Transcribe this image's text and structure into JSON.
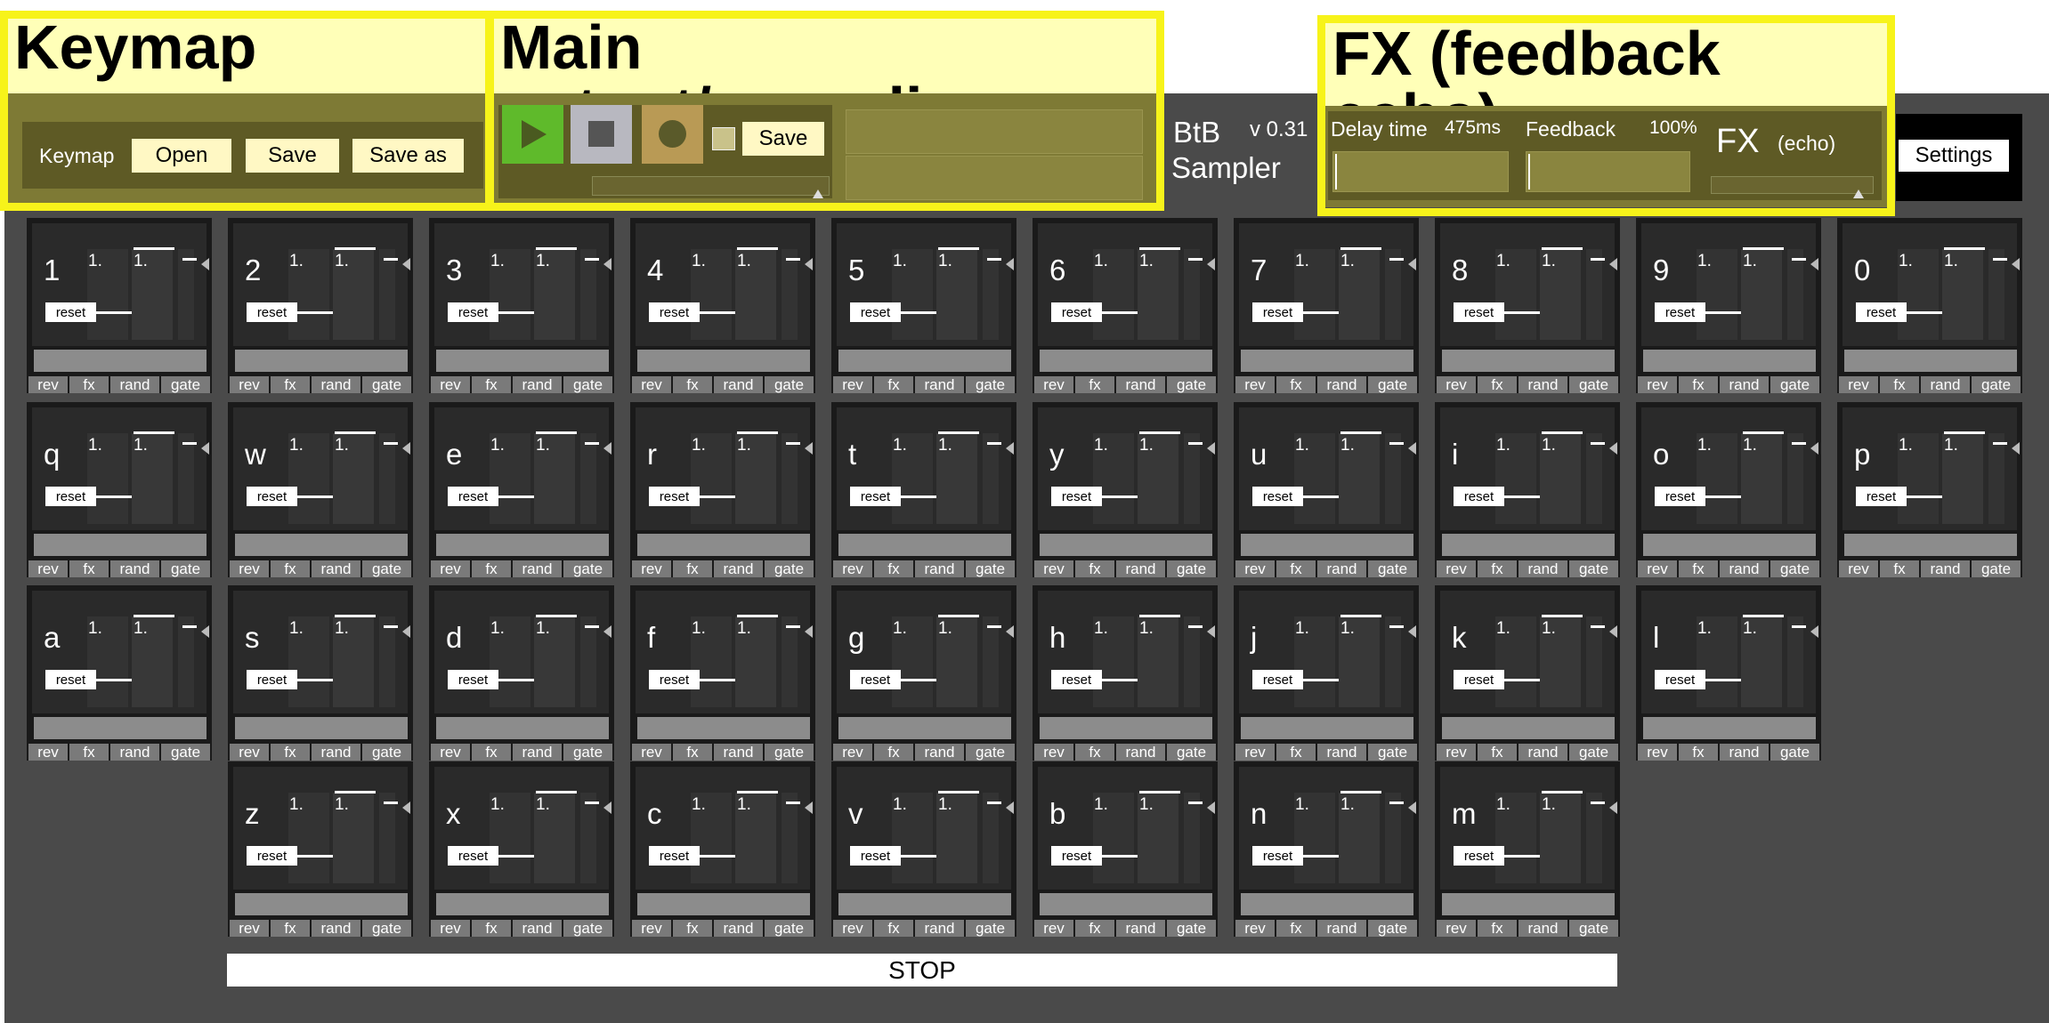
{
  "app": {
    "name_line1": "BtB",
    "name_line2": "Sampler",
    "version": "v 0.31"
  },
  "settings_label": "Settings",
  "stop_label": "STOP",
  "highlights": {
    "keymap": {
      "title": "Keymap",
      "label": "Keymap",
      "open": "Open",
      "save": "Save",
      "save_as": "Save as"
    },
    "main_output": {
      "title": "Main output/recording",
      "save": "Save"
    },
    "fx": {
      "title": "FX (feedback echo)",
      "delay_label": "Delay time",
      "delay_value": "475ms",
      "feedback_label": "Feedback",
      "feedback_value": "100%",
      "fx_label": "FX",
      "fx_sub": "(echo)"
    }
  },
  "slot_common": {
    "val1": "1.",
    "val2": "1.",
    "reset": "reset",
    "buttons": [
      "rev",
      "fx",
      "rand",
      "gate"
    ]
  },
  "rows": [
    [
      "1",
      "2",
      "3",
      "4",
      "5",
      "6",
      "7",
      "8",
      "9",
      "0"
    ],
    [
      "q",
      "w",
      "e",
      "r",
      "t",
      "y",
      "u",
      "i",
      "o",
      "p"
    ],
    [
      "a",
      "s",
      "d",
      "f",
      "g",
      "h",
      "j",
      "k",
      "l"
    ],
    [
      "z",
      "x",
      "c",
      "v",
      "b",
      "n",
      "m"
    ]
  ]
}
